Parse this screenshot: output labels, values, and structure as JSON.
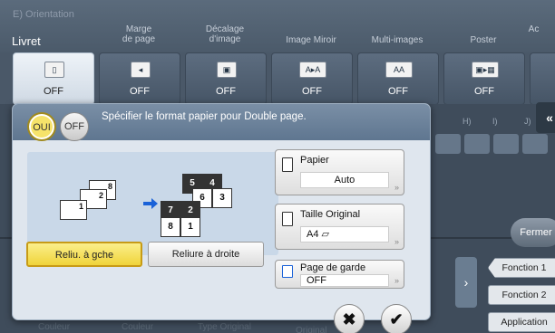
{
  "header": {
    "section_label": "E) Orientation",
    "mode_label": "Livret",
    "columns": [
      "Marge\nde page",
      "Décalage\nd'image",
      "Image Miroir",
      "Multi-images",
      "Poster",
      "Ac"
    ]
  },
  "tiles": [
    {
      "name": "livret",
      "value": "OFF",
      "icon": "book-icon"
    },
    {
      "name": "marge",
      "value": "OFF",
      "icon": "margin-icon"
    },
    {
      "name": "decalage",
      "value": "OFF",
      "icon": "shift-icon"
    },
    {
      "name": "miroir",
      "value": "OFF",
      "icon": "mirror-icon"
    },
    {
      "name": "multi",
      "value": "OFF",
      "icon": "multi-image-icon"
    },
    {
      "name": "poster",
      "value": "OFF",
      "icon": "poster-icon"
    }
  ],
  "right_panel": {
    "letters": [
      "H)",
      "I)",
      "J)"
    ],
    "close_label": "Fermer",
    "fn1": "Fonction 1",
    "fn2": "Fonction 2",
    "app": "Application"
  },
  "dialog": {
    "toggle_on": "OUI",
    "toggle_off": "OFF",
    "title": "Spécifier le format papier pour Double page.",
    "binding_left": "Reliu. à gche",
    "binding_right": "Reliure à droite",
    "paper_label": "Papier",
    "paper_value": "Auto",
    "orig_label": "Taille Original",
    "orig_value": "A4 ▱",
    "cover_label": "Page de garde",
    "cover_value": "OFF",
    "pages_left": [
      "8",
      "2",
      "1"
    ],
    "pages_right": [
      "5",
      "4",
      "6",
      "3",
      "7",
      "2",
      "8",
      "1"
    ]
  },
  "footer": {
    "cancel_symbol": "✖",
    "ok_symbol": "✔",
    "hidden_left_1": "Couleur",
    "hidden_left_2": "Couleur",
    "hidden_mid": "Type Original",
    "hidden_r": "Original"
  },
  "colors": {
    "accent_yellow": "#f0d43a",
    "arrow_blue": "#1a62d8",
    "header_blue": "#6a819b"
  }
}
